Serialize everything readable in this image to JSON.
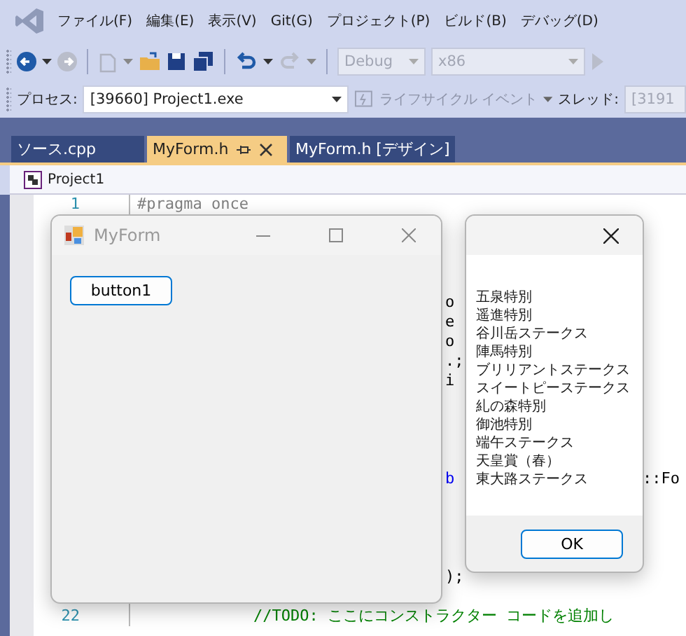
{
  "menu": [
    {
      "label": "ファイル(F)"
    },
    {
      "label": "編集(E)"
    },
    {
      "label": "表示(V)"
    },
    {
      "label": "Git(G)"
    },
    {
      "label": "プロジェクト(P)"
    },
    {
      "label": "ビルド(B)"
    },
    {
      "label": "デバッグ(D)"
    }
  ],
  "toolbar": {
    "config": "Debug",
    "platform": "x86"
  },
  "debug_bar": {
    "process_label": "プロセス:",
    "process": "[39660] Project1.exe",
    "lifecycle": "ライフサイクル イベント",
    "thread_label": "スレッド:",
    "thread": "[3191"
  },
  "tabs": [
    {
      "label": "ソース.cpp",
      "selected": false,
      "pinned": false,
      "closable": false
    },
    {
      "label": "MyForm.h",
      "selected": true,
      "pinned": true,
      "closable": true
    },
    {
      "label": "MyForm.h [デザイン]",
      "selected": false,
      "pinned": false,
      "closable": false
    }
  ],
  "navigation": {
    "project": "Project1"
  },
  "editor": {
    "lines": [
      {
        "kind": "code",
        "number": "1",
        "code": {
          "text": "#pragma once",
          "kind": "directive"
        }
      },
      {
        "kind": "covered"
      },
      {
        "kind": "covered"
      },
      {
        "kind": "covered"
      },
      {
        "kind": "covered"
      },
      {
        "kind": "code",
        "gap": {
          "text": "o",
          "kind": "plain"
        }
      },
      {
        "kind": "code",
        "gap": {
          "text": "e",
          "kind": "plain"
        }
      },
      {
        "kind": "code",
        "gap": {
          "text": "o",
          "kind": "plain"
        }
      },
      {
        "kind": "code",
        "gap": {
          "text": ".;",
          "kind": "plain"
        }
      },
      {
        "kind": "code",
        "gap": {
          "text": "i",
          "kind": "plain"
        }
      },
      {
        "kind": "covered"
      },
      {
        "kind": "covered"
      },
      {
        "kind": "covered"
      },
      {
        "kind": "covered"
      },
      {
        "kind": "code",
        "gap": {
          "text": "b",
          "kind": "keyword"
        },
        "right": "::Fo"
      },
      {
        "kind": "covered"
      },
      {
        "kind": "covered"
      },
      {
        "kind": "covered"
      },
      {
        "kind": "covered"
      },
      {
        "kind": "code",
        "gap": {
          "text": ");",
          "kind": "plain"
        }
      },
      {
        "kind": "covered"
      },
      {
        "kind": "code",
        "number": "22",
        "code": {
          "text": "//TODO: ここにコンストラクター コードを追加し",
          "kind": "comment"
        }
      }
    ]
  },
  "form_window": {
    "title": "MyForm",
    "button": "button1"
  },
  "message_box": {
    "lines": [
      "五泉特別",
      "遥進特別",
      "谷川岳ステークス",
      "陣馬特別",
      "ブリリアントステークス",
      "スイートピーステークス",
      "糺の森特別",
      "御池特別",
      "端午ステークス",
      "天皇賞（春）",
      "東大路ステークス"
    ],
    "ok": "OK"
  }
}
